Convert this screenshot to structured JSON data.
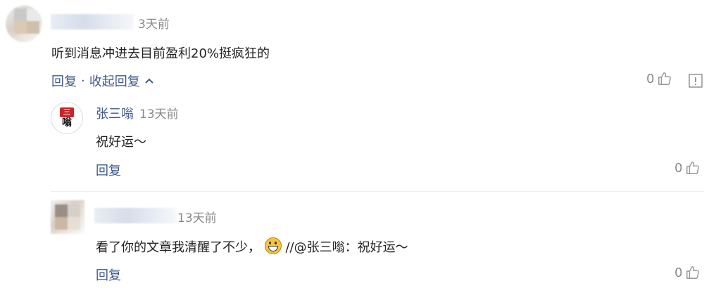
{
  "comment1": {
    "time": "3天前",
    "text": "听到消息冲进去目前盈利20%挺疯狂的",
    "reply_label": "回复",
    "separator": "·",
    "collapse_label": "收起回复",
    "like_count": "0",
    "report_icon": "report-icon",
    "like_icon": "thumbs-up-icon"
  },
  "reply1": {
    "avatar_top": "三",
    "avatar_bottom": "嗡",
    "author": "张三嗡",
    "time": "13天前",
    "text": "祝好运～",
    "reply_label": "回复",
    "like_count": "0"
  },
  "reply2": {
    "time": "13天前",
    "text_before": "看了你的文章我清醒了不少，",
    "emoji": "grin-emoji",
    "text_after": "//@张三嗡：祝好运～",
    "reply_label": "回复",
    "like_count": "0"
  },
  "colors": {
    "link": "#3f5a8a",
    "meta": "#888888",
    "avatar_red": "#c8262a"
  }
}
